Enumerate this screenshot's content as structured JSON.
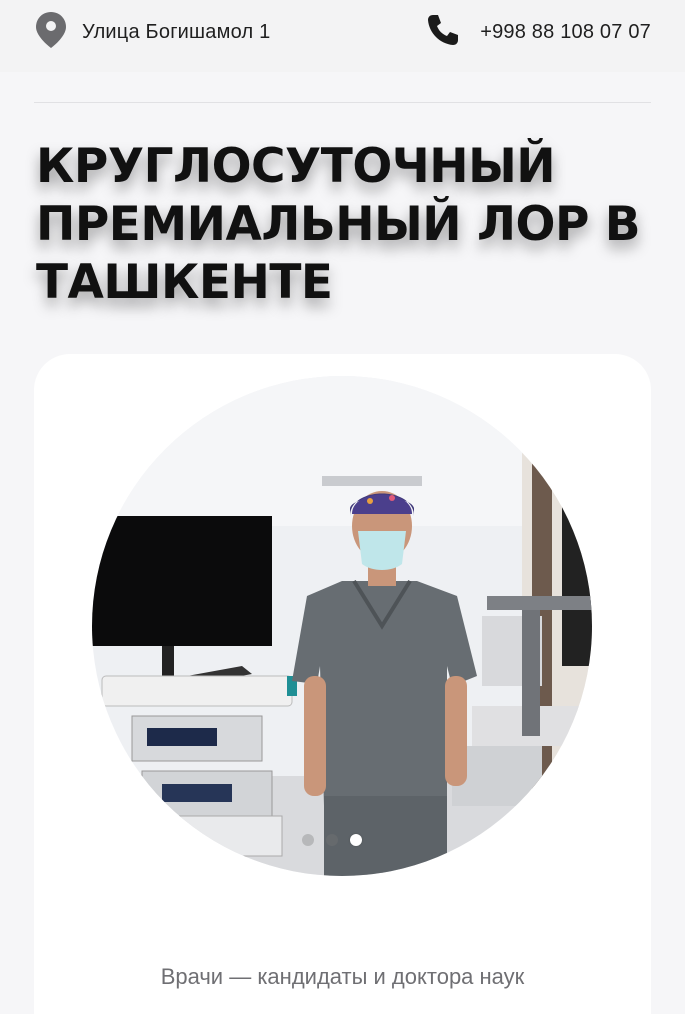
{
  "header": {
    "address": "Улица Богишамол 1",
    "phone": "+998 88 108 07 07",
    "address_icon": "map-pin-icon",
    "phone_icon": "phone-icon"
  },
  "hero": {
    "title": "Круглосуточный премиальный ЛОР в Ташкенте"
  },
  "slider": {
    "caption": "Врачи — кандидаты и доктора наук",
    "total_slides": 3,
    "active_slide": 3
  },
  "colors": {
    "background": "#f6f6f8",
    "card": "#ffffff",
    "text": "#111111",
    "muted_text": "#6f6f73"
  }
}
